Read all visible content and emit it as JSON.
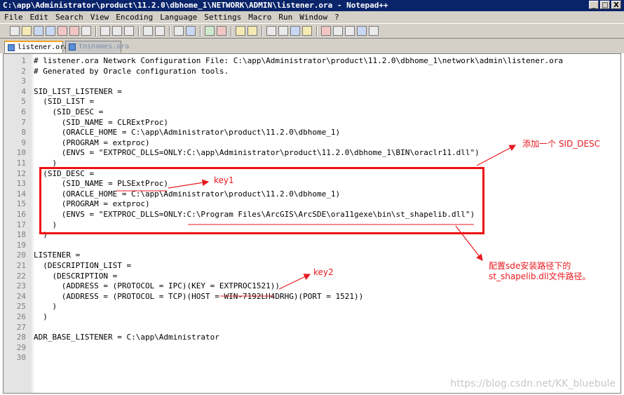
{
  "window": {
    "title": "C:\\app\\Administrator\\product\\11.2.0\\dbhome_1\\NETWORK\\ADMIN\\listener.ora - Notepad++",
    "buttons": [
      "_",
      "□",
      "X"
    ]
  },
  "menu": [
    "File",
    "Edit",
    "Search",
    "View",
    "Encoding",
    "Language",
    "Settings",
    "Macro",
    "Run",
    "Window",
    "?"
  ],
  "toolbar": {
    "icons": [
      "new-file-icon",
      "open-file-icon",
      "save-icon",
      "save-all-icon",
      "close-icon",
      "close-all-icon",
      "print-icon",
      "cut-icon",
      "copy-icon",
      "paste-icon",
      "undo-icon",
      "redo-icon",
      "find-icon",
      "replace-icon",
      "zoom-in-icon",
      "zoom-out-icon",
      "sync-vertical-icon",
      "sync-horizontal-icon",
      "word-wrap-icon",
      "show-all-chars-icon",
      "indent-guide-icon",
      "user-lang-icon",
      "record-macro-icon",
      "stop-macro-icon",
      "play-macro-icon",
      "play-multiple-icon",
      "save-macro-icon"
    ]
  },
  "tabs": [
    {
      "label": "listener.ora",
      "active": true
    },
    {
      "label": "tnsnames.ora",
      "active": false
    }
  ],
  "editor": {
    "lines": [
      {
        "n": "1",
        "text": "# listener.ora Network Configuration File: C:\\app\\Administrator\\product\\11.2.0\\dbhome_1\\network\\admin\\listener.ora"
      },
      {
        "n": "2",
        "text": "# Generated by Oracle configuration tools."
      },
      {
        "n": "3",
        "text": ""
      },
      {
        "n": "4",
        "text": "SID_LIST_LISTENER ="
      },
      {
        "n": "5",
        "text": "  (SID_LIST ="
      },
      {
        "n": "6",
        "text": "    (SID_DESC ="
      },
      {
        "n": "7",
        "text": "      (SID_NAME = CLRExtProc)"
      },
      {
        "n": "8",
        "text": "      (ORACLE_HOME = C:\\app\\Administrator\\product\\11.2.0\\dbhome_1)"
      },
      {
        "n": "9",
        "text": "      (PROGRAM = extproc)"
      },
      {
        "n": "10",
        "text": "      (ENVS = \"EXTPROC_DLLS=ONLY:C:\\app\\Administrator\\product\\11.2.0\\dbhome_1\\BIN\\oraclr11.dll\")"
      },
      {
        "n": "11",
        "text": "    )"
      },
      {
        "n": "12",
        "text": "  (SID_DESC ="
      },
      {
        "n": "13",
        "text": "      (SID_NAME = PLSExtProc)"
      },
      {
        "n": "14",
        "text": "      (ORACLE_HOME = C:\\app\\Administrator\\product\\11.2.0\\dbhome_1)"
      },
      {
        "n": "15",
        "text": "      (PROGRAM = extproc)"
      },
      {
        "n": "16",
        "text": "      (ENVS = \"EXTPROC_DLLS=ONLY:C:\\Program Files\\ArcGIS\\ArcSDE\\ora11gexe\\bin\\st_shapelib.dll\")"
      },
      {
        "n": "17",
        "text": "    )"
      },
      {
        "n": "18",
        "text": "  )"
      },
      {
        "n": "19",
        "text": ""
      },
      {
        "n": "20",
        "text": "LISTENER ="
      },
      {
        "n": "21",
        "text": "  (DESCRIPTION_LIST ="
      },
      {
        "n": "22",
        "text": "    (DESCRIPTION ="
      },
      {
        "n": "23",
        "text": "      (ADDRESS = (PROTOCOL = IPC)(KEY = EXTPROC1521))"
      },
      {
        "n": "24",
        "text": "      (ADDRESS = (PROTOCOL = TCP)(HOST = WIN-7192LH4DRHG)(PORT = 1521))"
      },
      {
        "n": "25",
        "text": "    )"
      },
      {
        "n": "26",
        "text": "  )"
      },
      {
        "n": "27",
        "text": ""
      },
      {
        "n": "28",
        "text": "ADR_BASE_LISTENER = C:\\app\\Administrator"
      },
      {
        "n": "29",
        "text": ""
      },
      {
        "n": "30",
        "text": ""
      }
    ]
  },
  "annotations": {
    "add_sid_desc": "添加一个 SID_DESC",
    "key1": "key1",
    "key2": "key2",
    "dll_note_line1": "配置sde安装路径下的",
    "dll_note_line2": "st_shapelib.dll文件路径。"
  },
  "watermark": "https://blog.csdn.net/KK_bluebule",
  "colors": {
    "annotation": "#e8191f",
    "title_bar": "#0a246a",
    "active_tab_accent": "#f5a623"
  }
}
